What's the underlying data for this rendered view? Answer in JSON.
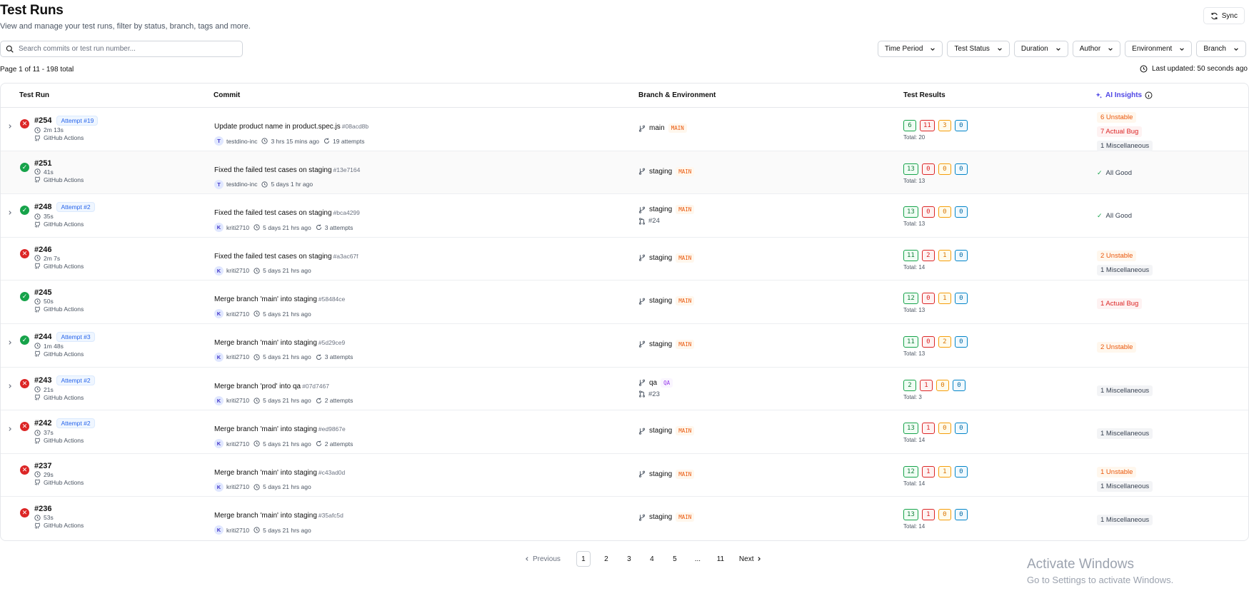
{
  "header": {
    "title": "Test Runs",
    "subtitle": "View and manage your test runs, filter by status, branch, tags and more.",
    "sync_label": "Sync"
  },
  "search": {
    "placeholder": "Search commits or test run number..."
  },
  "filters": [
    "Time Period",
    "Test Status",
    "Duration",
    "Author",
    "Environment",
    "Branch"
  ],
  "page_info": "Page 1 of 11  -  198 total",
  "last_updated": "Last updated: 50 seconds ago",
  "columns": {
    "test_run": "Test Run",
    "commit": "Commit",
    "branch_env": "Branch & Environment",
    "test_results": "Test Results",
    "ai_insights": "AI Insights"
  },
  "rows": [
    {
      "run": "#254",
      "attempt": "Attempt #19",
      "duration": "2m 13s",
      "ci": "GitHub Actions",
      "status": "fail",
      "expand": true,
      "highlight": false,
      "message": "Update product name in product.spec.js",
      "hash": "#08acd8b",
      "avatar": "T",
      "author": "testdino-inc",
      "time": "3 hrs 15 mins ago",
      "attempts": "19 attempts",
      "branch": "main",
      "env": "MAIN",
      "pr": "",
      "results": [
        "6",
        "11",
        "3",
        "0"
      ],
      "total": "Total: 20",
      "insights": [
        {
          "type": "unstable",
          "text": "6 Unstable"
        },
        {
          "type": "bug",
          "text": "7 Actual Bug"
        },
        {
          "type": "misc",
          "text": "1 Miscellaneous"
        }
      ]
    },
    {
      "run": "#251",
      "attempt": "",
      "duration": "41s",
      "ci": "GitHub Actions",
      "status": "pass",
      "expand": false,
      "highlight": true,
      "message": "Fixed the failed test cases on staging",
      "hash": "#13e7164",
      "avatar": "T",
      "author": "testdino-inc",
      "time": "5 days 1 hr ago",
      "attempts": "",
      "branch": "staging",
      "env": "MAIN",
      "pr": "",
      "results": [
        "13",
        "0",
        "0",
        "0"
      ],
      "total": "Total: 13",
      "insights": [
        {
          "type": "good",
          "text": "All Good"
        }
      ]
    },
    {
      "run": "#248",
      "attempt": "Attempt #2",
      "duration": "35s",
      "ci": "GitHub Actions",
      "status": "pass",
      "expand": true,
      "highlight": false,
      "message": "Fixed the failed test cases on staging",
      "hash": "#bca4299",
      "avatar": "K",
      "author": "kriti2710",
      "time": "5 days 21 hrs ago",
      "attempts": "3 attempts",
      "branch": "staging",
      "env": "MAIN",
      "pr": "#24",
      "results": [
        "13",
        "0",
        "0",
        "0"
      ],
      "total": "Total: 13",
      "insights": [
        {
          "type": "good",
          "text": "All Good"
        }
      ]
    },
    {
      "run": "#246",
      "attempt": "",
      "duration": "2m 7s",
      "ci": "GitHub Actions",
      "status": "fail",
      "expand": false,
      "highlight": false,
      "message": "Fixed the failed test cases on staging",
      "hash": "#a3ac67f",
      "avatar": "K",
      "author": "kriti2710",
      "time": "5 days 21 hrs ago",
      "attempts": "",
      "branch": "staging",
      "env": "MAIN",
      "pr": "",
      "results": [
        "11",
        "2",
        "1",
        "0"
      ],
      "total": "Total: 14",
      "insights": [
        {
          "type": "unstable",
          "text": "2 Unstable"
        },
        {
          "type": "misc",
          "text": "1 Miscellaneous"
        }
      ]
    },
    {
      "run": "#245",
      "attempt": "",
      "duration": "50s",
      "ci": "GitHub Actions",
      "status": "pass",
      "expand": false,
      "highlight": false,
      "message": "Merge branch 'main' into staging",
      "hash": "#58484ce",
      "avatar": "K",
      "author": "kriti2710",
      "time": "5 days 21 hrs ago",
      "attempts": "",
      "branch": "staging",
      "env": "MAIN",
      "pr": "",
      "results": [
        "12",
        "0",
        "1",
        "0"
      ],
      "total": "Total: 13",
      "insights": [
        {
          "type": "bug",
          "text": "1 Actual Bug"
        }
      ]
    },
    {
      "run": "#244",
      "attempt": "Attempt #3",
      "duration": "1m 48s",
      "ci": "GitHub Actions",
      "status": "pass",
      "expand": true,
      "highlight": false,
      "message": "Merge branch 'main' into staging",
      "hash": "#5d29ce9",
      "avatar": "K",
      "author": "kriti2710",
      "time": "5 days 21 hrs ago",
      "attempts": "3 attempts",
      "branch": "staging",
      "env": "MAIN",
      "pr": "",
      "results": [
        "11",
        "0",
        "2",
        "0"
      ],
      "total": "Total: 13",
      "insights": [
        {
          "type": "unstable",
          "text": "2 Unstable"
        }
      ]
    },
    {
      "run": "#243",
      "attempt": "Attempt #2",
      "duration": "21s",
      "ci": "GitHub Actions",
      "status": "fail",
      "expand": true,
      "highlight": false,
      "message": "Merge branch 'prod' into qa",
      "hash": "#07d7467",
      "avatar": "K",
      "author": "kriti2710",
      "time": "5 days 21 hrs ago",
      "attempts": "2 attempts",
      "branch": "qa",
      "env": "QA",
      "pr": "#23",
      "results": [
        "2",
        "1",
        "0",
        "0"
      ],
      "total": "Total: 3",
      "insights": [
        {
          "type": "misc",
          "text": "1 Miscellaneous"
        }
      ]
    },
    {
      "run": "#242",
      "attempt": "Attempt #2",
      "duration": "37s",
      "ci": "GitHub Actions",
      "status": "fail",
      "expand": true,
      "highlight": false,
      "message": "Merge branch 'main' into staging",
      "hash": "#ed9867e",
      "avatar": "K",
      "author": "kriti2710",
      "time": "5 days 21 hrs ago",
      "attempts": "2 attempts",
      "branch": "staging",
      "env": "MAIN",
      "pr": "",
      "results": [
        "13",
        "1",
        "0",
        "0"
      ],
      "total": "Total: 14",
      "insights": [
        {
          "type": "misc",
          "text": "1 Miscellaneous"
        }
      ]
    },
    {
      "run": "#237",
      "attempt": "",
      "duration": "29s",
      "ci": "GitHub Actions",
      "status": "fail",
      "expand": false,
      "highlight": false,
      "message": "Merge branch 'main' into staging",
      "hash": "#c43ad0d",
      "avatar": "K",
      "author": "kriti2710",
      "time": "5 days 21 hrs ago",
      "attempts": "",
      "branch": "staging",
      "env": "MAIN",
      "pr": "",
      "results": [
        "12",
        "1",
        "1",
        "0"
      ],
      "total": "Total: 14",
      "insights": [
        {
          "type": "unstable",
          "text": "1 Unstable"
        },
        {
          "type": "misc",
          "text": "1 Miscellaneous"
        }
      ]
    },
    {
      "run": "#236",
      "attempt": "",
      "duration": "53s",
      "ci": "GitHub Actions",
      "status": "fail",
      "expand": false,
      "highlight": false,
      "message": "Merge branch 'main' into staging",
      "hash": "#35afc5d",
      "avatar": "K",
      "author": "kriti2710",
      "time": "5 days 21 hrs ago",
      "attempts": "",
      "branch": "staging",
      "env": "MAIN",
      "pr": "",
      "results": [
        "13",
        "1",
        "0",
        "0"
      ],
      "total": "Total: 14",
      "insights": [
        {
          "type": "misc",
          "text": "1 Miscellaneous"
        }
      ]
    }
  ],
  "pagination": {
    "previous": "Previous",
    "pages": [
      "1",
      "2",
      "3",
      "4",
      "5",
      "...",
      "11"
    ],
    "current": "1",
    "next": "Next"
  },
  "watermark": {
    "line1": "Activate Windows",
    "line2": "Go to Settings to activate Windows."
  }
}
